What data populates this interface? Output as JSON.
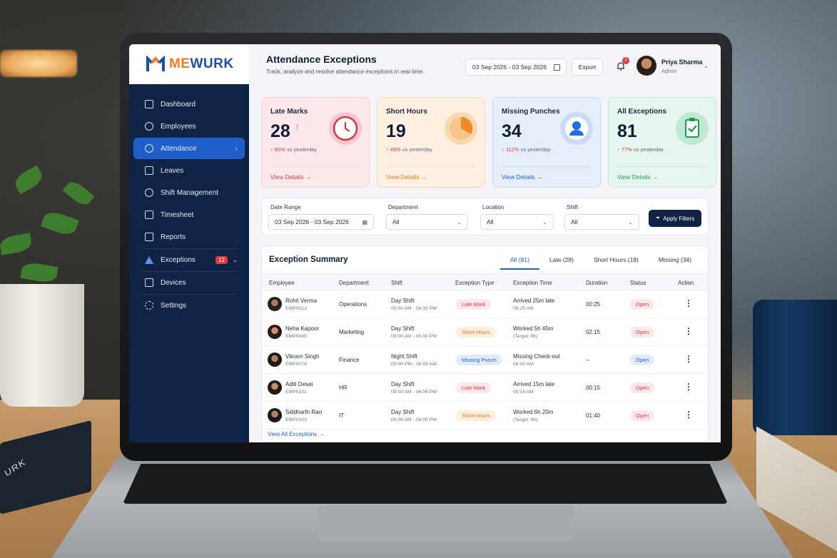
{
  "app": {
    "logo_prefix": "ME",
    "logo_suffix": "WURK",
    "notebook_text": "URK"
  },
  "header": {
    "title": "Attendance Exceptions",
    "subtitle": "Track, analyze and resolve attendance exceptions in real-time.",
    "date_range": "03 Sep 2026 - 03 Sep 2026",
    "export_label": "Export",
    "notification_count": "3",
    "user_name": "Priya Sharma",
    "user_role": "Admin"
  },
  "sidebar": {
    "items": [
      {
        "label": "Dashboard",
        "icon": "home-icon"
      },
      {
        "label": "Employees",
        "icon": "users-icon"
      },
      {
        "label": "Attendance",
        "icon": "clock-icon",
        "active": true
      },
      {
        "label": "Leaves",
        "icon": "calendar-icon"
      },
      {
        "label": "Shift Management",
        "icon": "shift-icon"
      },
      {
        "label": "Timesheet",
        "icon": "document-icon"
      },
      {
        "label": "Reports",
        "icon": "chart-icon"
      },
      {
        "label": "Exceptions",
        "icon": "warning-icon",
        "badge": "12"
      },
      {
        "label": "Devices",
        "icon": "device-icon"
      },
      {
        "label": "Settings",
        "icon": "gear-icon"
      }
    ]
  },
  "cards": [
    {
      "label": "Late Marks",
      "value": "28",
      "delta_pct": "85%",
      "delta_text": "vs yesterday",
      "link": "View Details",
      "accent": "#d43a3a"
    },
    {
      "label": "Short Hours",
      "value": "19",
      "delta_pct": "45%",
      "delta_text": "vs yesterday",
      "link": "View Details",
      "accent": "#e07a1f"
    },
    {
      "label": "Missing Punches",
      "value": "34",
      "delta_pct": "112%",
      "delta_text": "vs yesterday",
      "link": "View Details",
      "accent": "#1f5fc9"
    },
    {
      "label": "All Exceptions",
      "value": "81",
      "delta_pct": "77%",
      "delta_text": "vs yesterday",
      "link": "View Details",
      "accent": "#1f9d55"
    }
  ],
  "filters": {
    "date_label": "Date Range",
    "date_value": "03 Sep 2026 - 03 Sep 2026",
    "dept_label": "Department",
    "dept_value": "All",
    "loc_label": "Location",
    "loc_value": "All",
    "shift_label": "Shift",
    "shift_value": "All",
    "apply_label": "Apply Filters"
  },
  "summary": {
    "title": "Exception Summary",
    "tabs": [
      "All (81)",
      "Late (28)",
      "Short Hours (19)",
      "Missing (34)"
    ],
    "columns": [
      "Employee",
      "Department",
      "Shift",
      "Exception Type",
      "Exception Time",
      "Duration",
      "Status",
      "Action"
    ],
    "rows": [
      {
        "name": "Rohit Verma",
        "id": "EMP0012",
        "dept": "Operations",
        "shift": "Day Shift",
        "shift_time": "09:00 AM - 06:00 PM",
        "type": "Late Mark",
        "time": "Arrived 25m late",
        "time_sub": "09:25 AM",
        "duration": "00:25",
        "status": "Open"
      },
      {
        "name": "Neha Kapoor",
        "id": "EMP0045",
        "dept": "Marketing",
        "shift": "Day Shift",
        "shift_time": "09:00 AM - 06:00 PM",
        "type": "Short Hours",
        "time": "Worked 5h 45m",
        "time_sub": "(Target: 8h)",
        "duration": "02:15",
        "status": "Open"
      },
      {
        "name": "Vikram Singh",
        "id": "EMP0078",
        "dept": "Finance",
        "shift": "Night Shift",
        "shift_time": "09:00 PM - 06:00 AM",
        "type": "Missing Punch",
        "time": "Missing Check-out",
        "time_sub": "06:00 AM",
        "duration": "–",
        "status": "Open"
      },
      {
        "name": "Aditi Desai",
        "id": "EMP0101",
        "dept": "HR",
        "shift": "Day Shift",
        "shift_time": "09:00 AM - 06:00 PM",
        "type": "Late Mark",
        "time": "Arrived 15m late",
        "time_sub": "09:15 AM",
        "duration": "00:15",
        "status": "Open"
      },
      {
        "name": "Siddharth Rao",
        "id": "EMP0103",
        "dept": "IT",
        "shift": "Day Shift",
        "shift_time": "09:00 AM - 06:00 PM",
        "type": "Short Hours",
        "time": "Worked 6h 20m",
        "time_sub": "(Target: 8h)",
        "duration": "01:40",
        "status": "Open"
      }
    ],
    "view_all": "View All Exceptions"
  }
}
